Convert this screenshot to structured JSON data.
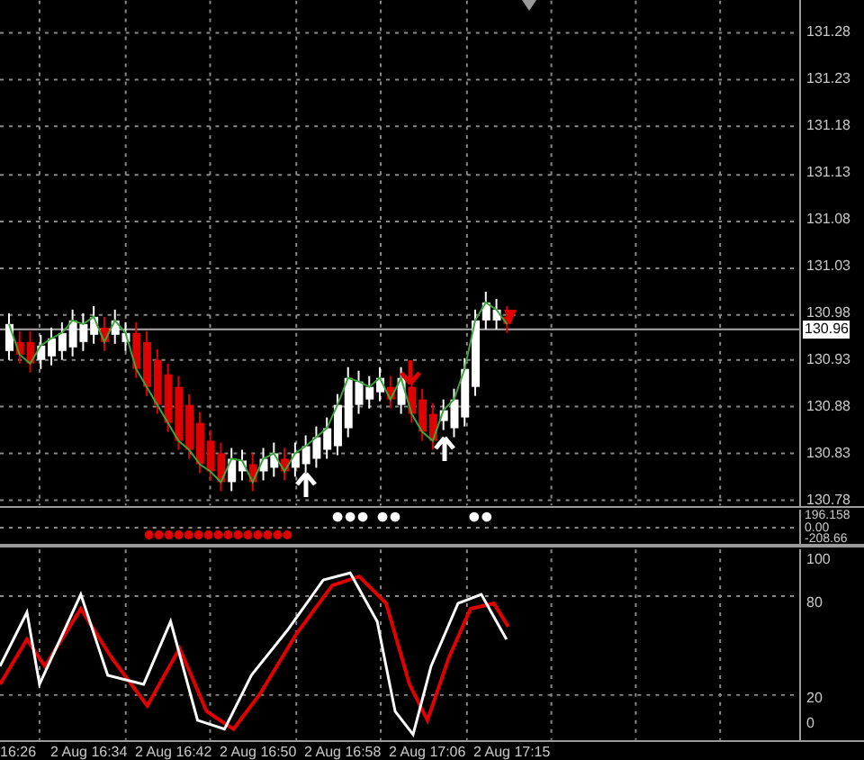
{
  "price_axis": {
    "labels": [
      "131.28",
      "131.23",
      "131.18",
      "131.13",
      "131.08",
      "131.03",
      "130.98",
      "130.93",
      "130.88",
      "130.83",
      "130.78"
    ],
    "current_price": "130.96"
  },
  "indicator_axis": {
    "labels": [
      "196.158",
      "0.00",
      "-208.66"
    ]
  },
  "oscillator_axis": {
    "labels": [
      "100",
      "80",
      "20",
      "0"
    ]
  },
  "time_axis": {
    "labels": [
      "16:26",
      "2 Aug 16:34",
      "2 Aug 16:42",
      "2 Aug 16:50",
      "2 Aug 16:58",
      "2 Aug 17:06",
      "2 Aug 17:15"
    ]
  }
}
